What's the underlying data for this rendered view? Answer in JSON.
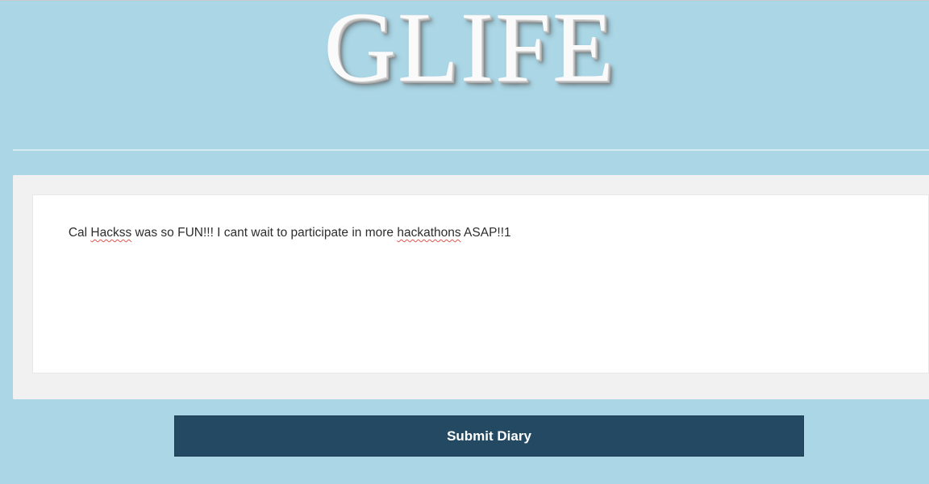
{
  "header": {
    "logo_text": "GLIFE"
  },
  "diary": {
    "entry_segments": [
      {
        "text": "Cal ",
        "misspelled": false
      },
      {
        "text": "Hackss",
        "misspelled": true
      },
      {
        "text": " was so FUN!!! I cant wait to participate in more ",
        "misspelled": false
      },
      {
        "text": "hackathons",
        "misspelled": true
      },
      {
        "text": " ASAP!!1",
        "misspelled": false
      }
    ]
  },
  "actions": {
    "submit_label": "Submit Diary"
  },
  "colors": {
    "page_background": "#abd6e5",
    "panel_background": "#f1f1f1",
    "button_background": "#234a62",
    "button_text": "#ffffff",
    "spellcheck_underline": "#e0574e"
  }
}
